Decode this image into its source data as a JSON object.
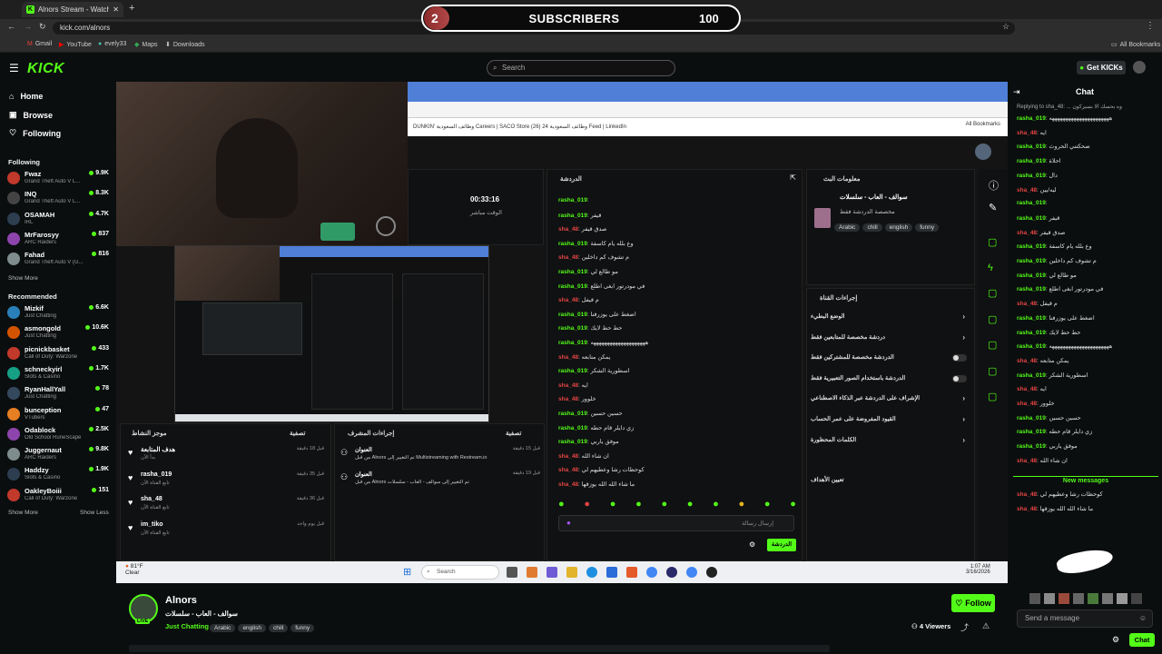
{
  "browser": {
    "tab_title": "Alnors Stream - Watch Live",
    "url": "kick.com/alnors",
    "bookmarks": [
      "Gmail",
      "YouTube",
      "evely33",
      "Maps",
      "Downloads"
    ],
    "all_bookmarks": "All Bookmarks"
  },
  "overlay": {
    "subs_current": "2",
    "subs_label": "SUBSCRIBERS",
    "subs_goal": "100"
  },
  "header": {
    "logo": "KICK",
    "search_placeholder": "Search",
    "get_kicks": "Get KICKs"
  },
  "sidebar": {
    "nav": [
      {
        "label": "Home",
        "icon": "home-icon"
      },
      {
        "label": "Browse",
        "icon": "browse-icon"
      },
      {
        "label": "Following",
        "icon": "heart-icon"
      }
    ],
    "following_title": "Following",
    "following": [
      {
        "name": "Fwaz",
        "game": "Grand Theft Auto V L...",
        "viewers": "9.9K",
        "color": "#c0392b"
      },
      {
        "name": "INQ",
        "game": "Grand Theft Auto V L...",
        "viewers": "8.3K",
        "color": "#444444"
      },
      {
        "name": "OSAMAH",
        "game": "IRL",
        "viewers": "4.7K",
        "color": "#2c3e50"
      },
      {
        "name": "MrFarosyy",
        "game": "ARC Raiders",
        "viewers": "837",
        "color": "#8e44ad"
      },
      {
        "name": "Fahad",
        "game": "Grand Theft Auto V (G...",
        "viewers": "816",
        "color": "#7f8c8d"
      }
    ],
    "show_more": "Show More",
    "recommended_title": "Recommended",
    "recommended": [
      {
        "name": "Mizkif",
        "game": "Just Chatting",
        "viewers": "6.6K",
        "color": "#2980b9"
      },
      {
        "name": "asmongold",
        "game": "Just Chatting",
        "viewers": "10.6K",
        "color": "#d35400"
      },
      {
        "name": "picnickbasket",
        "game": "Call of Duty: Warzone",
        "viewers": "433",
        "color": "#c0392b"
      },
      {
        "name": "schneckyirl",
        "game": "Slots & Casino",
        "viewers": "1.7K",
        "color": "#16a085"
      },
      {
        "name": "RyanHallYall",
        "game": "Just Chatting",
        "viewers": "78",
        "color": "#34495e"
      },
      {
        "name": "bunception",
        "game": "VTubers",
        "viewers": "47",
        "color": "#e67e22"
      },
      {
        "name": "Odablock",
        "game": "Old School RuneScape",
        "viewers": "2.5K",
        "color": "#8e44ad"
      },
      {
        "name": "Juggernaut",
        "game": "ARC Raiders",
        "viewers": "9.8K",
        "color": "#7f8c8d"
      },
      {
        "name": "Haddzy",
        "game": "Slots & Casino",
        "viewers": "1.9K",
        "color": "#2c3e50"
      },
      {
        "name": "OakleyBoiii",
        "game": "Call of Duty: Warzone",
        "viewers": "151",
        "color": "#c0392b"
      }
    ],
    "show_more_2": "Show More",
    "show_less": "Show Less"
  },
  "stream": {
    "inner_bookmarks": "DUNKIN'   وظائف السعودية   Careers | SACO Store   وظائف السعودية 24   (26) Feed | LinkedIn",
    "inner_all_bookmarks": "All Bookmarks",
    "uptime": "00:33:16",
    "uptime_label": "الوقت مباشر",
    "chat_panel_title": "الدردشة",
    "stream_info_title": "معلومات البث",
    "stream_title_ar": "سوالف - العاب - سلسلات",
    "stream_category_ar": "مخصصة الدردشة فقط",
    "stream_tags": [
      "Arabic",
      "chill",
      "english",
      "funny"
    ],
    "mod_panel_title": "إجراءات القناة",
    "mod_rows": [
      "الوضع البطيء",
      "دردشة مخصصة للمتابعين فقط",
      "الدردشة مخصصة للمشتركين فقط",
      "الدردشة باستخدام الصور التعبيرية فقط",
      "الإشراف على الدردشة عبر الذكاء الاصطناعي",
      "القيود المفروضة على عمر الحساب",
      "الكلمات المحظورة"
    ],
    "mod_goal_label": "تعيين الأهداف",
    "activity_title": "موجز النشاط",
    "activity_filter": "تصفية",
    "activity_items": [
      {
        "name": "هدف المتابعة",
        "sub": "بدأ الآن",
        "time": "قبل 18 دقيقة"
      },
      {
        "name": "rasha_019",
        "sub": "تابع القناة الآن",
        "time": "قبل 35 دقيقة"
      },
      {
        "name": "sha_48",
        "sub": "تابع القناة الآن",
        "time": "قبل 36 دقيقة"
      },
      {
        "name": "im_tiko",
        "sub": "تابع القناة الآن",
        "time": "قبل يوم واحد"
      }
    ],
    "mod_actions_title": "إجراءات المشرف",
    "mod_action_items": [
      {
        "head": "العنوان",
        "body": "من قبل Alnors تم التغيير إلى Multistreaming with Restream.io",
        "time": "قبل 15 دقيقة"
      },
      {
        "head": "العنوان",
        "body": "من قبل Alnors تم التغيير إلى سوالف - العاب - سلسلات",
        "time": "قبل 19 دقيقة"
      }
    ],
    "chat_input_placeholder": "إرسال رسالة",
    "chat_send": "الدردشة",
    "taskbar_search": "Search",
    "weather_temp": "81°F",
    "weather_desc": "Clear",
    "clock_time": "1:07 AM",
    "clock_date": "3/16/2026"
  },
  "inner_chat": [
    {
      "u": "rasha_019",
      "t": "",
      "s": false
    },
    {
      "u": "rasha_019",
      "t": "قيفر",
      "s": false
    },
    {
      "u": "sha_48",
      "t": "صدق قيفر",
      "s": true
    },
    {
      "u": "rasha_019",
      "t": "وع بلله يام كاسفة",
      "s": false
    },
    {
      "u": "sha_48",
      "t": "م تشوف كم داخلين",
      "s": true
    },
    {
      "u": "rasha_019",
      "t": "مو طالع لي",
      "s": false
    },
    {
      "u": "rasha_019",
      "t": "في مودرتور ابغى اطلع",
      "s": false
    },
    {
      "u": "sha_48",
      "t": "م قيفل",
      "s": true
    },
    {
      "u": "rasha_019",
      "t": "اضغط على يوزرفنا",
      "s": false
    },
    {
      "u": "rasha_019",
      "t": "حط حط لايك",
      "s": false
    },
    {
      "u": "rasha_019",
      "t": "ههههههههههههههههههههه",
      "s": false
    },
    {
      "u": "sha_48",
      "t": "يمكن متابعه",
      "s": true
    },
    {
      "u": "rasha_019",
      "t": "اسطورية الشكر",
      "s": false
    },
    {
      "u": "sha_48",
      "t": "ايه",
      "s": true
    },
    {
      "u": "sha_48",
      "t": "خلوور",
      "s": true
    },
    {
      "u": "rasha_019",
      "t": "حسين حسين",
      "s": false
    },
    {
      "u": "rasha_019",
      "t": "زي دايلر قام حطه",
      "s": false
    },
    {
      "u": "rasha_019",
      "t": "موفق ياربي",
      "s": false
    },
    {
      "u": "sha_48",
      "t": "ان شاء الله",
      "s": true
    },
    {
      "u": "sha_48",
      "t": "كوحظات رشا وعطيهم لي",
      "s": true
    },
    {
      "u": "sha_48",
      "t": "ما شاء الله الله يوزقها",
      "s": true
    }
  ],
  "chat": {
    "title": "Chat",
    "replying": "Replying to sha_48: ... وه بحسك الا بسيركون",
    "messages": [
      {
        "u": "rasha_019",
        "t": "ههههههههههههههههههههههه",
        "s": false
      },
      {
        "u": "sha_48",
        "t": "ايه",
        "s": true
      },
      {
        "u": "rasha_019",
        "t": "ضحكتني الحروث",
        "s": false
      },
      {
        "u": "rasha_019",
        "t": "احلاة",
        "s": false
      },
      {
        "u": "rasha_019",
        "t": "دال",
        "s": false
      },
      {
        "u": "sha_48",
        "t": "ليه/يين",
        "s": true
      },
      {
        "u": "rasha_019",
        "t": "",
        "s": false
      },
      {
        "u": "rasha_019",
        "t": "قيفر",
        "s": false
      },
      {
        "u": "sha_48",
        "t": "صدق قيفر",
        "s": true
      },
      {
        "u": "rasha_019",
        "t": "وع بلله يام كاسفة",
        "s": false
      },
      {
        "u": "rasha_019",
        "t": "م تشوف كم داخلين",
        "s": false
      },
      {
        "u": "rasha_019",
        "t": "مو طالع لي",
        "s": false
      },
      {
        "u": "rasha_019",
        "t": "في مودرتور ابغى اطلع",
        "s": false
      },
      {
        "u": "sha_48",
        "t": "م قيفل",
        "s": true
      },
      {
        "u": "rasha_019",
        "t": "اضغط على يوزرفنا",
        "s": false
      },
      {
        "u": "rasha_019",
        "t": "حط حط لايك",
        "s": false
      },
      {
        "u": "rasha_019",
        "t": "ههههههههههههههههههههههه",
        "s": false
      },
      {
        "u": "sha_48",
        "t": "يمكن متابعه",
        "s": true
      },
      {
        "u": "rasha_019",
        "t": "اسطورية الشكر",
        "s": false
      },
      {
        "u": "sha_48",
        "t": "ايه",
        "s": true
      },
      {
        "u": "sha_48",
        "t": "خلوور",
        "s": true
      },
      {
        "u": "rasha_019",
        "t": "حسين حسين",
        "s": false
      },
      {
        "u": "rasha_019",
        "t": "زي دايلر قام حطه",
        "s": false
      },
      {
        "u": "rasha_019",
        "t": "موفق ياربي",
        "s": false
      },
      {
        "u": "sha_48",
        "t": "ان شاء الله",
        "s": true
      }
    ],
    "new_messages": "New messages",
    "after_new": [
      {
        "u": "sha_48",
        "t": "كوحظات رشا وعطيهم لي",
        "s": true
      },
      {
        "u": "sha_48",
        "t": "ما شاء الله الله يوزقها",
        "s": true
      }
    ],
    "send_placeholder": "Send a message",
    "chat_button": "Chat"
  },
  "channel": {
    "name": "Alnors",
    "title": "سوالف - العاب - سلسلات",
    "category": "Just Chatting",
    "tags": [
      "Arabic",
      "english",
      "chill",
      "funny"
    ],
    "live_badge": "LIVE",
    "follow_label": "Follow",
    "viewers": "4 Viewers"
  },
  "colors": {
    "accent": "#53fc18",
    "bg": "#0b0e0f",
    "sub_red": "#e54444"
  }
}
